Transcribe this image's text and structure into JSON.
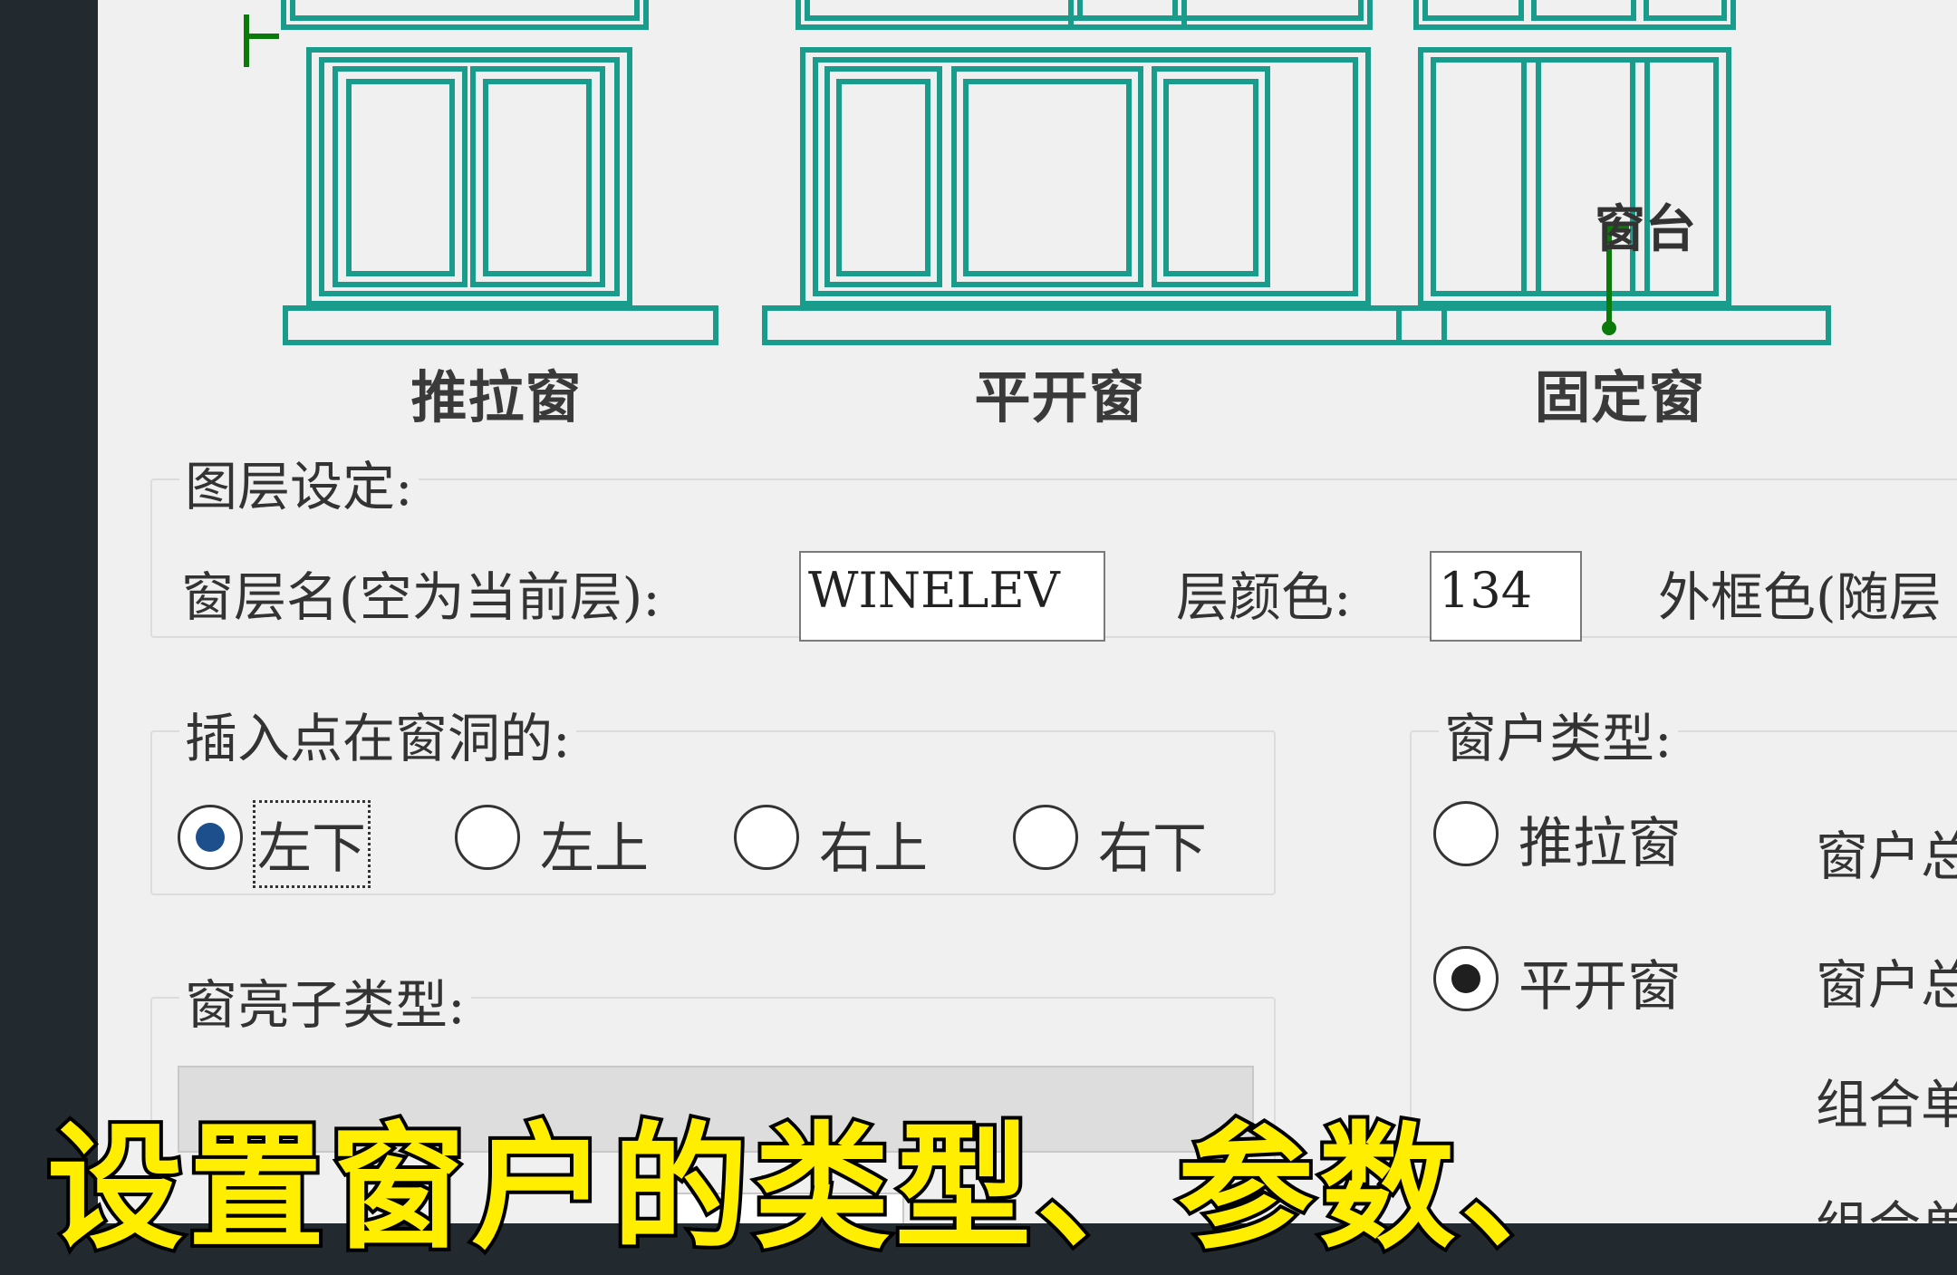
{
  "preview": {
    "captions": [
      "推拉窗",
      "平开窗",
      "固定窗"
    ],
    "callout": "窗台"
  },
  "layer": {
    "legend": "图层设定:",
    "name_label": "窗层名(空为当前层):",
    "name_value": "WINELEV",
    "color_label": "层颜色:",
    "color_value": "134",
    "frame_color_label": "外框色(随层"
  },
  "insert_point": {
    "legend": "插入点在窗洞的:",
    "options": [
      {
        "label": "左下",
        "checked": true
      },
      {
        "label": "左上",
        "checked": false
      },
      {
        "label": "右上",
        "checked": false
      },
      {
        "label": "右下",
        "checked": false
      }
    ]
  },
  "window_type": {
    "legend": "窗户类型:",
    "options": [
      {
        "label": "推拉窗",
        "checked": false
      },
      {
        "label": "平开窗",
        "checked": true
      }
    ],
    "right_labels": [
      "窗户总",
      "窗户总",
      "组合单",
      "组合单"
    ]
  },
  "sublight": {
    "legend": "窗亮子类型:"
  },
  "subtitle": "设置窗户的类型、参数、",
  "colors": {
    "window_stroke": "#1a9c8c",
    "callout": "#0a7a0a",
    "subtitle_fill": "#ffee00"
  }
}
